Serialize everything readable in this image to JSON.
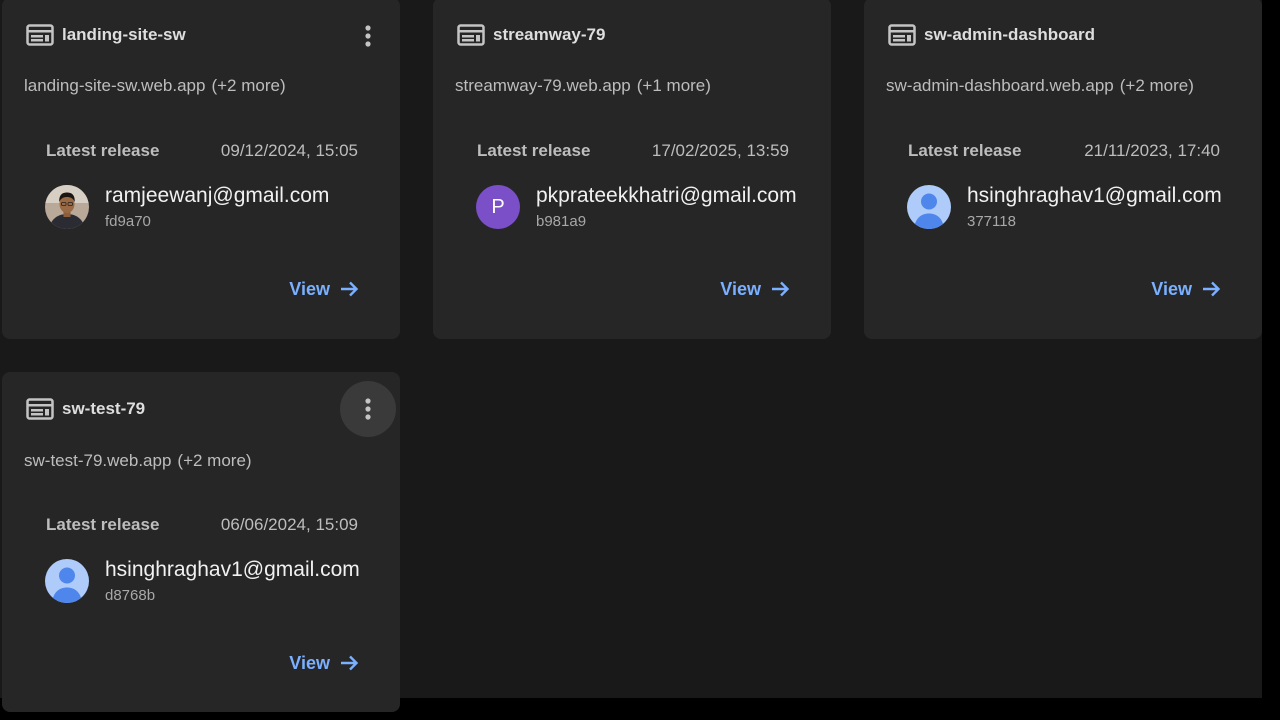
{
  "sites": [
    {
      "name": "landing-site-sw",
      "domain": "landing-site-sw.web.app",
      "extra": "(+2 more)",
      "release_label": "Latest release",
      "release_date": "09/12/2024, 15:05",
      "user_email": "ramjeewanj@gmail.com",
      "commit": "fd9a70",
      "avatar": "photo",
      "view_label": "View"
    },
    {
      "name": "streamway-79",
      "domain": "streamway-79.web.app",
      "extra": "(+1 more)",
      "release_label": "Latest release",
      "release_date": "17/02/2025, 13:59",
      "user_email": "pkprateekkhatri@gmail.com",
      "commit": "b981a9",
      "avatar_letter": "P",
      "view_label": "View"
    },
    {
      "name": "sw-admin-dashboard",
      "domain": "sw-admin-dashboard.web.app",
      "extra": "(+2 more)",
      "release_label": "Latest release",
      "release_date": "21/11/2023, 17:40",
      "user_email": "hsinghraghav1@gmail.com",
      "commit": "377118",
      "avatar": "default-person",
      "view_label": "View"
    },
    {
      "name": "sw-test-79",
      "domain": "sw-test-79.web.app",
      "extra": "(+2 more)",
      "release_label": "Latest release",
      "release_date": "06/06/2024, 15:09",
      "user_email": "hsinghraghav1@gmail.com",
      "commit": "d8768b",
      "avatar": "default-person",
      "view_label": "View"
    }
  ],
  "colors": {
    "card_bg": "#262626",
    "page_bg": "#191919",
    "link": "#7ab0ff",
    "avatar_purple": "#7b4fc8",
    "avatar_default": "#aecbfa"
  }
}
